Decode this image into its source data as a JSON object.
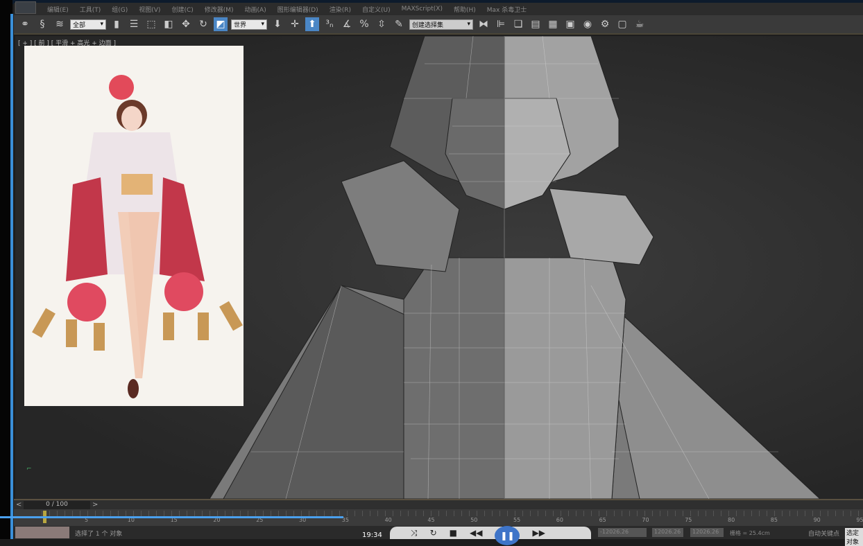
{
  "menu": [
    "编辑(E)",
    "工具(T)",
    "组(G)",
    "视图(V)",
    "创建(C)",
    "修改器(M)",
    "动画(A)",
    "图形编辑器(D)",
    "渲染(R)",
    "自定义(U)",
    "MAXScript(X)",
    "帮助(H)",
    "Max 杀毒卫士"
  ],
  "toolbar": {
    "filter": "全部",
    "coord_system": "世界",
    "named_selection": "创建选择集"
  },
  "viewport": {
    "label": "[ + ] [ 前 ] [ 平滑 + 高光 + 边面 ]"
  },
  "timeline": {
    "frame": "0 / 100",
    "ticks": [
      "5",
      "10",
      "15",
      "20",
      "25",
      "30",
      "35",
      "40",
      "45",
      "50",
      "55",
      "60",
      "65",
      "70",
      "75",
      "80",
      "85",
      "90",
      "95"
    ]
  },
  "status": {
    "message": "选择了 1 个 对象",
    "time": "19:34",
    "x": "-12026.26",
    "y": "12026.26",
    "z": "12026.26",
    "grid": "栅格 = 25.4cm",
    "autokey": "自动关键点",
    "selected": "选定对象"
  },
  "colors": {
    "accent": "#3a8fd8",
    "active_tool": "#4a86c5"
  }
}
